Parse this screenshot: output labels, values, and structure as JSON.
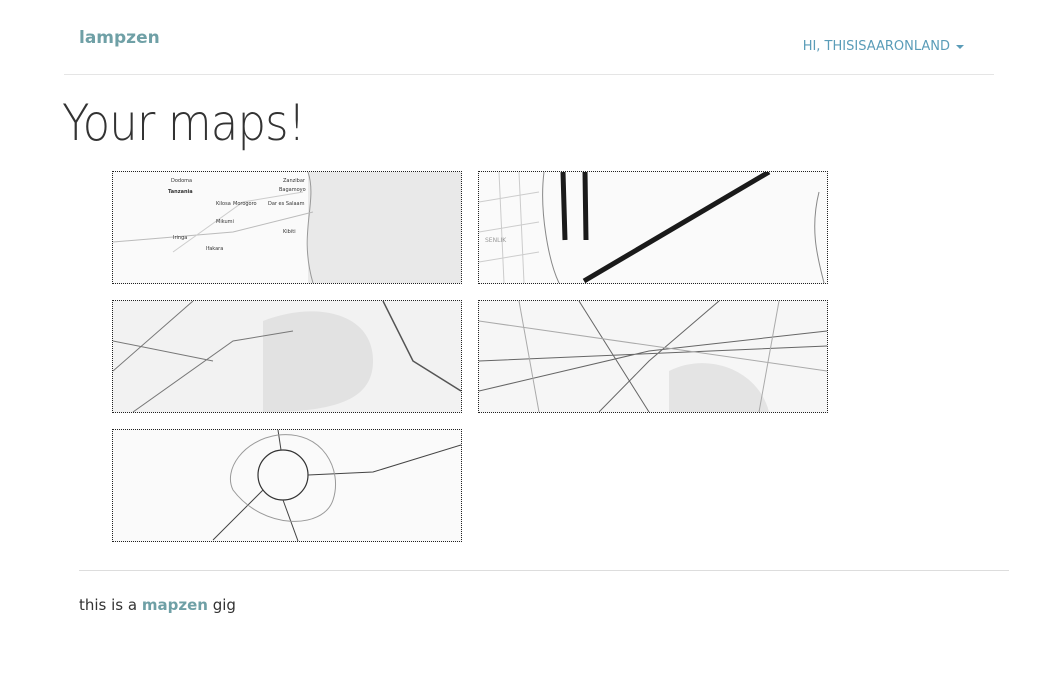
{
  "header": {
    "brand": "lampzen",
    "user_menu": "HI, THISISAARONLAND"
  },
  "page_title": "Your maps!",
  "maps": [
    {
      "labels": [
        "Dodoma",
        "Tanzania",
        "Zanzibar",
        "Bagamoyo",
        "Kilosa",
        "Morogoro",
        "Dar es Salaam",
        "Mikumi",
        "Kibiti",
        "Iringa",
        "Ifakara"
      ]
    },
    {
      "labels": [
        "SENLIK"
      ]
    },
    {
      "labels": []
    },
    {
      "labels": []
    },
    {
      "labels": []
    }
  ],
  "footer": {
    "prefix": "this is a ",
    "link": "mapzen",
    "suffix": " gig"
  }
}
